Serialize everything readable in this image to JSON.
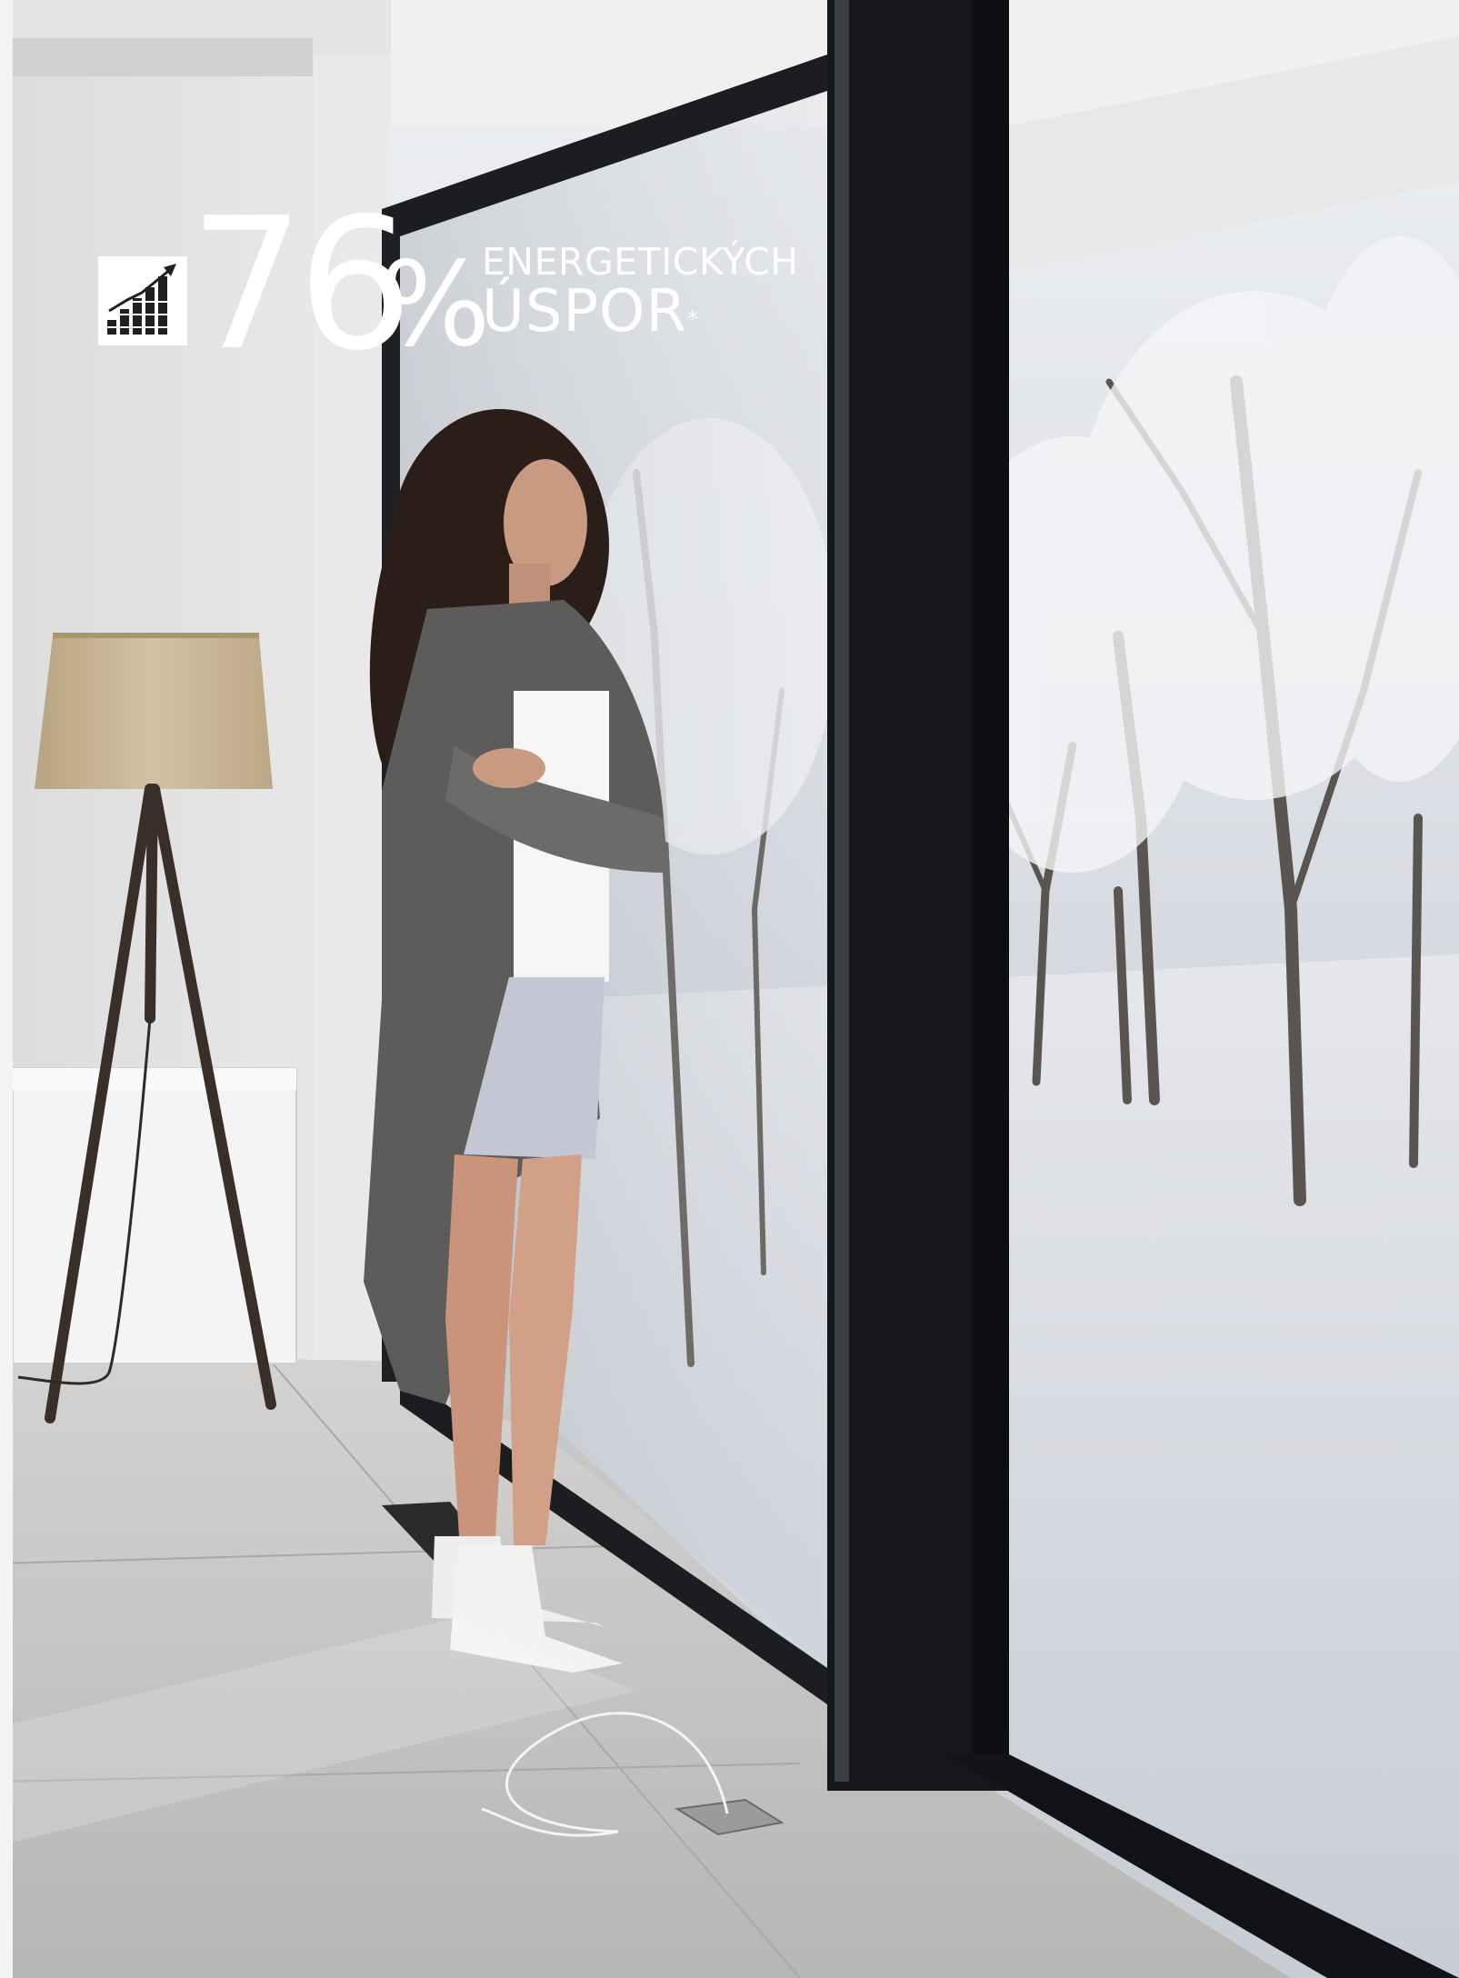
{
  "headline": {
    "icon": "bar-chart-growth-icon",
    "number": "76",
    "percent_sign": "%",
    "caption_line1": "ENERGETICKÝCH",
    "caption_line2": "ÚSPOR",
    "asterisk": "*"
  },
  "colors": {
    "text": "#ffffff",
    "window_frame": "#15171b",
    "wall": "#e6e6e6",
    "floor": "#c9c8c6",
    "snow": "#d8dbe2",
    "lamp_shade": "#c7b494"
  },
  "scene_objects": [
    "woman",
    "floor-lamp",
    "sideboard",
    "sliding-window",
    "winter-trees",
    "floor-socket"
  ]
}
